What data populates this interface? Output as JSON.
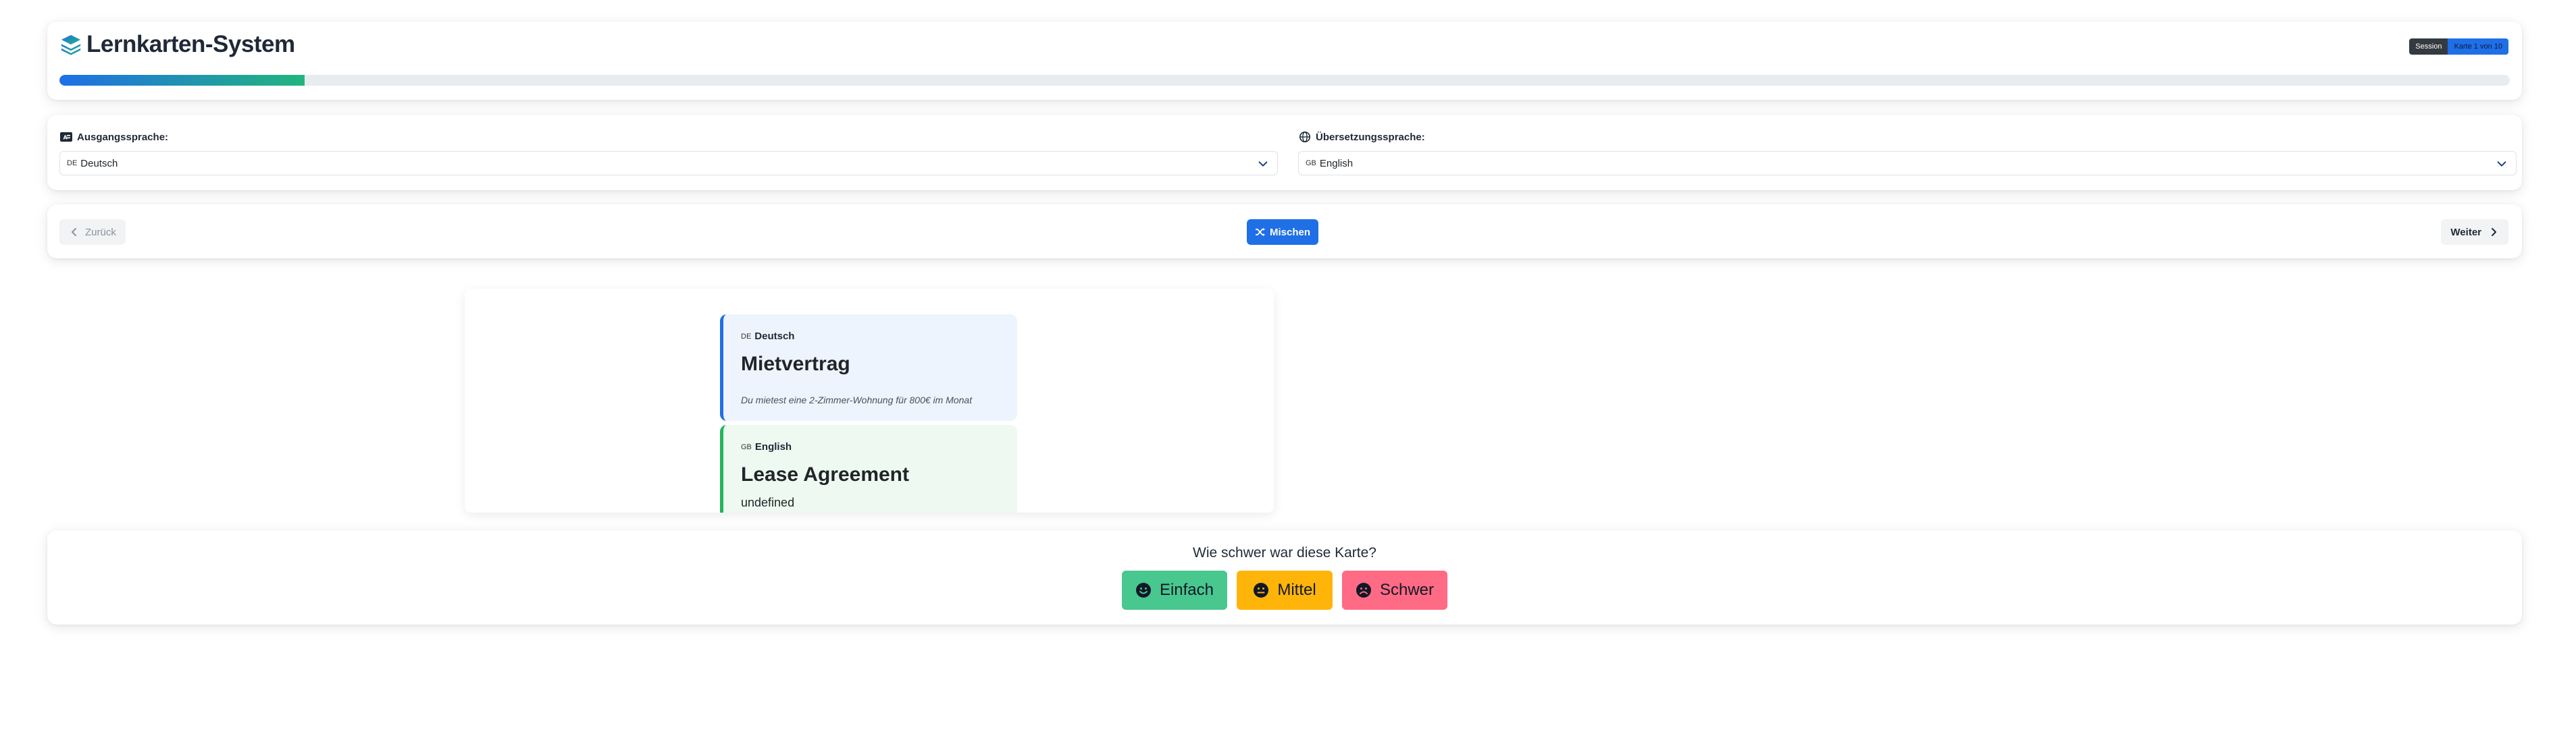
{
  "header": {
    "title": "Lernkarten-System",
    "session_label": "Session",
    "card_counter": "Karte 1 von 10",
    "progress_fraction": 0.1,
    "brand_color": "#1f6fe6",
    "progress_gradient_end": "#22b57c"
  },
  "languages": {
    "source": {
      "label": "Ausgangssprache:",
      "icon": "language-icon",
      "flag": "DE",
      "selected": "Deutsch"
    },
    "target": {
      "label": "Übersetzungssprache:",
      "icon": "globe-icon",
      "flag": "GB",
      "selected": "English"
    }
  },
  "navigation": {
    "back_label": "Zurück",
    "shuffle_label": "Mischen",
    "next_label": "Weiter"
  },
  "card": {
    "front": {
      "flag": "DE",
      "language": "Deutsch",
      "word": "Mietvertrag",
      "example": "Du mietest eine 2-Zimmer-Wohnung für 800€ im Monat"
    },
    "back": {
      "flag": "GB",
      "language": "English",
      "word": "Lease Agreement",
      "extra": "undefined"
    }
  },
  "rating": {
    "question": "Wie schwer war diese Karte?",
    "easy_label": "Einfach",
    "medium_label": "Mittel",
    "hard_label": "Schwer",
    "easy_color": "#48c78e",
    "medium_color": "#ffb40a",
    "hard_color": "#ff6a84"
  }
}
